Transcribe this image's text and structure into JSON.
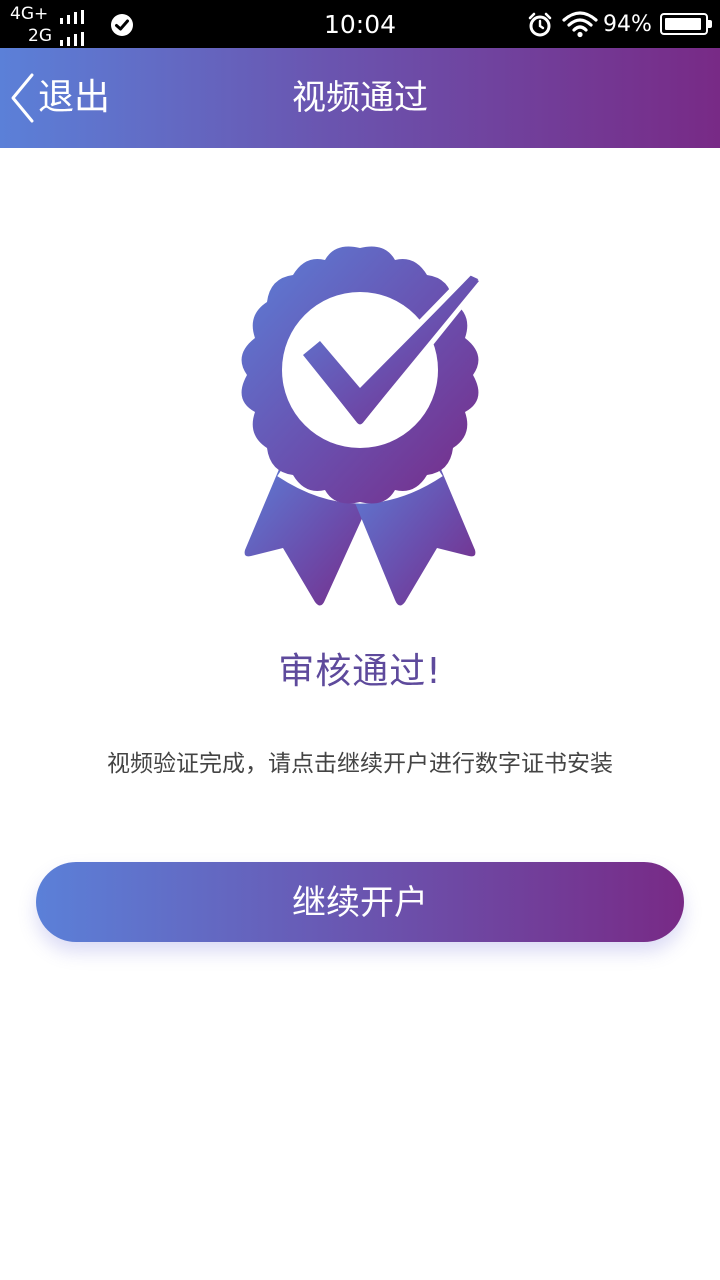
{
  "status_bar": {
    "network_1": "4G+",
    "network_2": "2G",
    "time": "10:04",
    "battery_percent": "94%",
    "icons": [
      "check-circle-icon",
      "alarm-icon",
      "wifi-icon",
      "battery-icon"
    ]
  },
  "header": {
    "back_label": "退出",
    "title": "视频通过"
  },
  "main": {
    "badge_icon": "verified-badge-icon",
    "success_title": "审核通过!",
    "description": "视频验证完成，请点击继续开户进行数字证书安装",
    "continue_label": "继续开户"
  },
  "colors": {
    "gradient_start": "#5b80d8",
    "gradient_end": "#782a86",
    "title_text": "#5e4a9c"
  }
}
